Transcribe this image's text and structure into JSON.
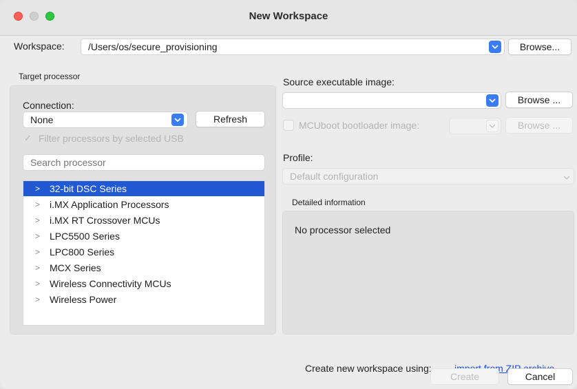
{
  "window": {
    "title": "New Workspace"
  },
  "workspace": {
    "label": "Workspace:",
    "path": "/Users/os/secure_provisioning",
    "browse_label": "Browse..."
  },
  "target": {
    "heading": "Target processor",
    "connection_label": "Connection:",
    "connection_value": "None",
    "refresh_label": "Refresh",
    "filter_label": "Filter processors by selected USB",
    "search_placeholder": "Search processor",
    "items": [
      {
        "label": "32-bit DSC Series"
      },
      {
        "label": "i.MX Application Processors"
      },
      {
        "label": "i.MX RT Crossover MCUs"
      },
      {
        "label": "LPC5500 Series"
      },
      {
        "label": "LPC800 Series"
      },
      {
        "label": "MCX Series"
      },
      {
        "label": "Wireless Connectivity MCUs"
      },
      {
        "label": "Wireless Power"
      }
    ]
  },
  "source": {
    "label": "Source executable image:",
    "value": "",
    "browse_label": "Browse ...",
    "mcuboot_label": "MCUboot bootloader image:",
    "mcuboot_browse_label": "Browse ..."
  },
  "profile": {
    "label": "Profile:",
    "value": "Default configuration"
  },
  "details": {
    "heading": "Detailed information",
    "text": "No processor selected"
  },
  "footer": {
    "create_using_label": "Create new workspace using:",
    "import_link": "import from ZIP archive",
    "create_label": "Create",
    "cancel_label": "Cancel"
  },
  "colors": {
    "accent": "#2158d4",
    "combo_button": "#3a7cf5",
    "link": "#1a4ed8"
  }
}
